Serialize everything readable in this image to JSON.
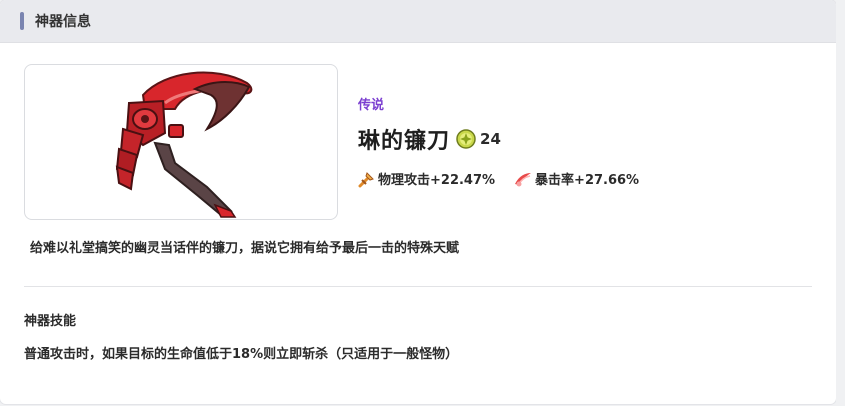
{
  "header": {
    "title": "神器信息"
  },
  "artifact": {
    "rarity": "传说",
    "name": "琳的镰刀",
    "level": "24",
    "stats": [
      {
        "icon": "sword-icon",
        "label": "物理攻击+22.47%"
      },
      {
        "icon": "crit-slash-icon",
        "label": "暴击率+27.66%"
      }
    ],
    "description": "给难以礼堂搞笑的幽灵当话伴的镰刀，据说它拥有给予最后一击的特殊天赋"
  },
  "skill": {
    "title": "神器技能",
    "description": "普通攻击时，如果目标的生命值低于18%则立即斩杀（只适用于一般怪物）"
  },
  "colors": {
    "accent_bar": "#7a84b0",
    "rarity": "#7b3fd0",
    "scythe_red": "#d8262c"
  }
}
